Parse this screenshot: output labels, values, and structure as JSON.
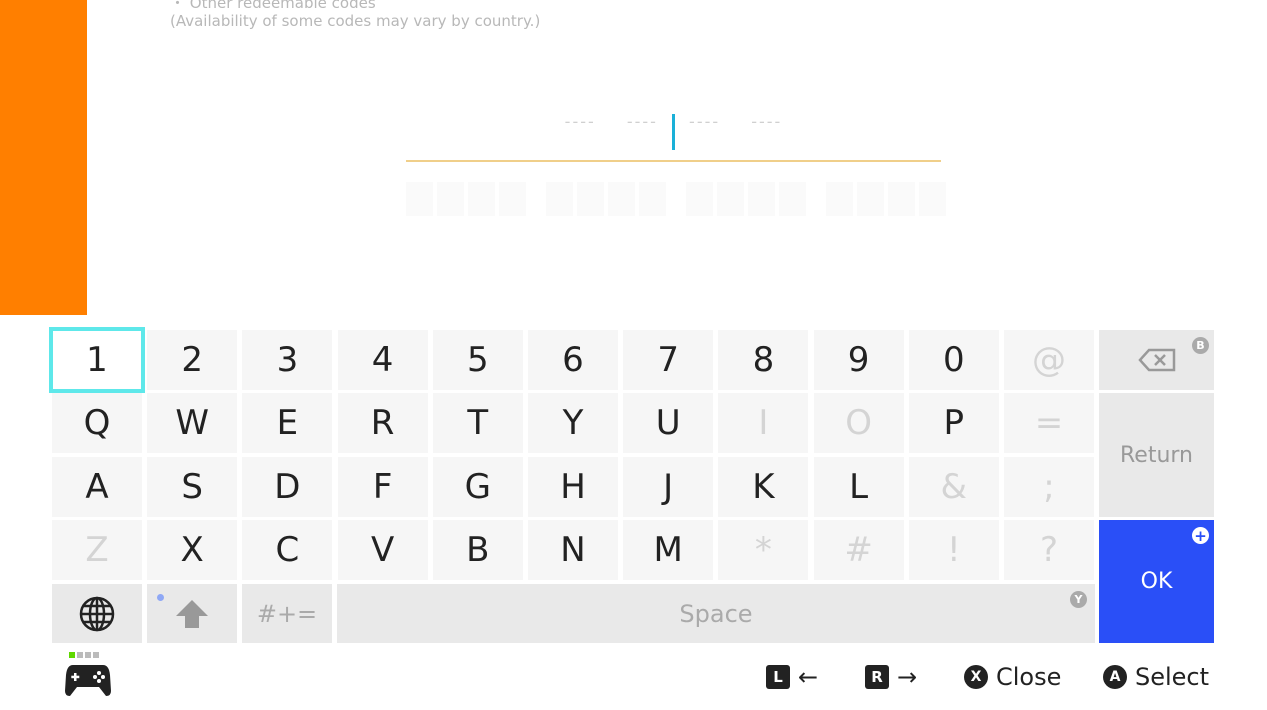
{
  "info": {
    "line1": "・ Other redeemable codes",
    "line2": "(Availability of some codes may vary by country.)"
  },
  "code_input": {
    "placeholders": [
      "----",
      "----",
      "----",
      "----"
    ]
  },
  "keyboard": {
    "rows": [
      [
        "1",
        "2",
        "3",
        "4",
        "5",
        "6",
        "7",
        "8",
        "9",
        "0",
        "@"
      ],
      [
        "Q",
        "W",
        "E",
        "R",
        "T",
        "Y",
        "U",
        "I",
        "O",
        "P",
        "="
      ],
      [
        "A",
        "S",
        "D",
        "F",
        "G",
        "H",
        "J",
        "K",
        "L",
        "&",
        ";"
      ],
      [
        "Z",
        "X",
        "C",
        "V",
        "B",
        "N",
        "M",
        "*",
        "#",
        "!",
        "?"
      ]
    ],
    "disabled": [
      "@",
      "I",
      "O",
      "=",
      "&",
      ";",
      "Z",
      "*",
      "#",
      "!",
      "?"
    ],
    "selected": "1",
    "symbols_label": "#+=",
    "space_label": "Space",
    "return_label": "Return",
    "ok_label": "OK",
    "backspace_badge": "B",
    "space_badge": "Y",
    "ok_badge": "+"
  },
  "footer": {
    "hints": [
      {
        "button": "L",
        "label": "←"
      },
      {
        "button": "R",
        "label": "→"
      },
      {
        "button": "X",
        "label": "Close"
      },
      {
        "button": "A",
        "label": "Select"
      }
    ]
  },
  "colors": {
    "accent_orange": "#ff7f00",
    "ok_blue": "#2a4ff7",
    "selection": "#5ee8ea",
    "caret": "#1ab0d8"
  }
}
